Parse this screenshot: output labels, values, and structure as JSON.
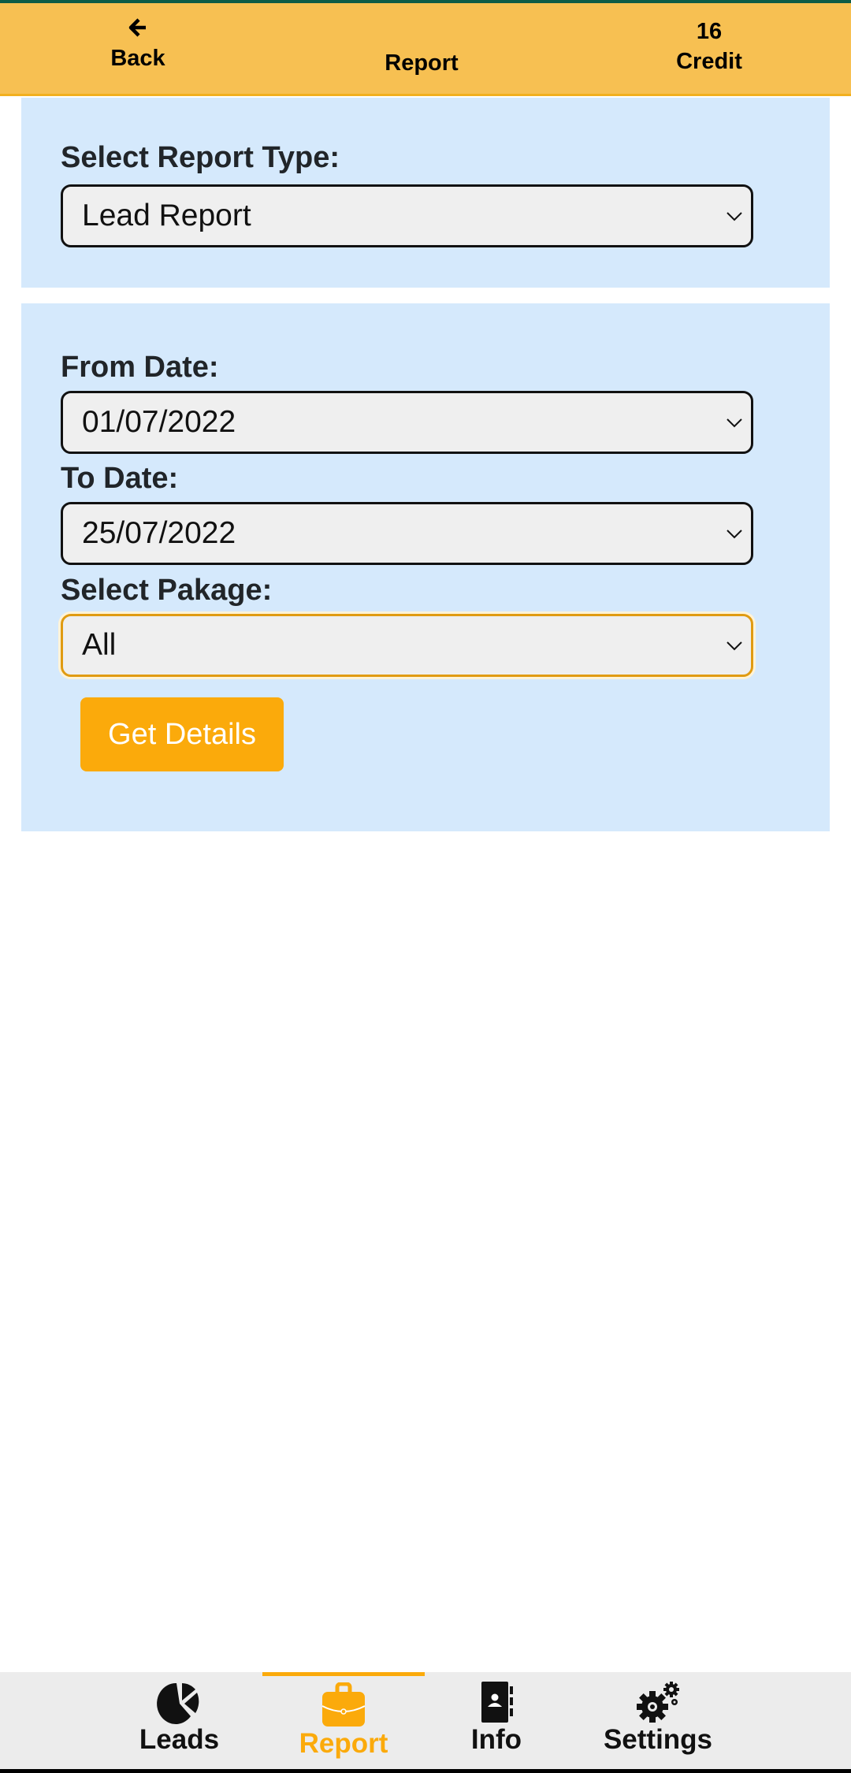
{
  "header": {
    "back_icon": "arrow-left-icon",
    "back_label": "Back",
    "title": "Report",
    "credit_value": "16",
    "credit_label": "Credit"
  },
  "report_type": {
    "label": "Select Report Type:",
    "value": "Lead Report"
  },
  "filters": {
    "from_label": "From Date:",
    "from_value": "01/07/2022",
    "to_label": "To Date:",
    "to_value": "25/07/2022",
    "package_label": "Select Pakage:",
    "package_value": "All",
    "submit_label": "Get Details"
  },
  "bottom_nav": {
    "active": "Report",
    "items": [
      {
        "label": "Leads",
        "icon": "pie-chart-icon"
      },
      {
        "label": "Report",
        "icon": "briefcase-icon"
      },
      {
        "label": "Info",
        "icon": "contact-book-icon"
      },
      {
        "label": "Settings",
        "icon": "gears-icon"
      }
    ]
  },
  "colors": {
    "header_bg": "#f7c052",
    "accent": "#fbaa0b",
    "panel_bg": "#d5e9fc",
    "status_bar": "#0d5c46"
  }
}
